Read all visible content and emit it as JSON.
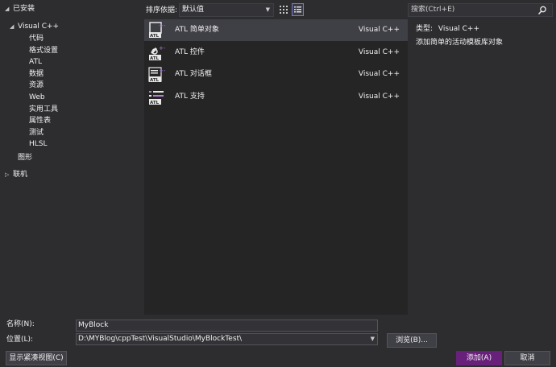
{
  "tree": {
    "installed_label": "已安装",
    "visual_cpp_label": "Visual C++",
    "children": [
      "代码",
      "格式设置",
      "ATL",
      "数据",
      "资源",
      "Web",
      "实用工具",
      "属性表",
      "测试",
      "HLSL"
    ],
    "graphics_label": "图形",
    "online_label": "联机"
  },
  "sort": {
    "label": "排序依据:",
    "value": "默认值"
  },
  "templates": [
    {
      "name": "ATL 简单对象",
      "lang": "Visual C++",
      "icon": "atl-simple-object-icon"
    },
    {
      "name": "ATL 控件",
      "lang": "Visual C++",
      "icon": "atl-control-icon"
    },
    {
      "name": "ATL 对话框",
      "lang": "Visual C++",
      "icon": "atl-dialog-icon"
    },
    {
      "name": "ATL 支持",
      "lang": "Visual C++",
      "icon": "atl-support-icon"
    }
  ],
  "search": {
    "placeholder": "搜索(Ctrl+E)"
  },
  "details": {
    "type_label": "类型:",
    "type_value": "Visual C++",
    "description": "添加简单的活动模板库对象"
  },
  "form": {
    "name_label": "名称(N):",
    "name_value": "MyBlock",
    "location_label": "位置(L):",
    "location_value": "D:\\MYBlog\\cppTest\\VisualStudio\\MyBlockTest\\",
    "browse_label": "浏览(B)...",
    "compact_view_label": "显示紧凑视图(C)",
    "add_label": "添加(A)",
    "cancel_label": "取消"
  },
  "colors": {
    "accent": "#68217a",
    "icon_purple": "#b180d7",
    "background": "#2d2d30",
    "list_background": "#252526",
    "selected_row": "#3f3f46"
  }
}
